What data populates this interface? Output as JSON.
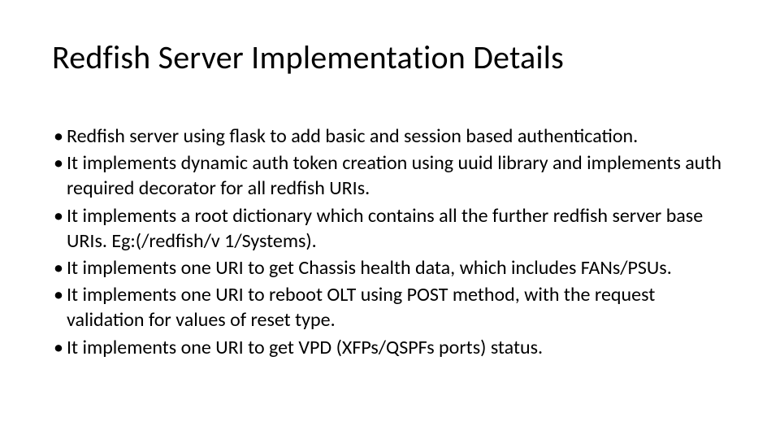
{
  "slide": {
    "title": "Redfish Server Implementation Details",
    "bullet_marker": "•",
    "bullets": [
      "Redfish server using flask to add basic and session based authentication.",
      "It implements dynamic auth token creation using uuid library and implements auth required decorator for all redfish URIs.",
      "It implements a root dictionary which contains all the further redfish server base URIs. Eg:(/redfish/v 1/Systems).",
      "It implements one URI to get Chassis health data, which includes FANs/PSUs.",
      "It implements one URI to reboot OLT using POST method, with the request validation for values of reset type.",
      "It implements one URI to get VPD (XFPs/QSPFs ports) status."
    ]
  }
}
